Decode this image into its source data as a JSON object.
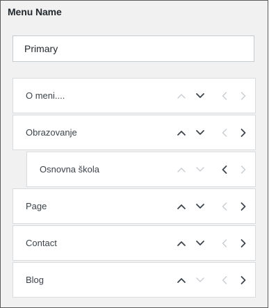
{
  "menu_name": {
    "label": "Menu Name",
    "value": "Primary"
  },
  "items": [
    {
      "label": "O meni....",
      "depth": 0,
      "move_up": false,
      "move_down": true,
      "move_out": false,
      "move_in": false
    },
    {
      "label": "Obrazovanje",
      "depth": 0,
      "move_up": true,
      "move_down": true,
      "move_out": false,
      "move_in": true
    },
    {
      "label": "Osnovna škola",
      "depth": 1,
      "move_up": false,
      "move_down": false,
      "move_out": true,
      "move_in": false
    },
    {
      "label": "Page",
      "depth": 0,
      "move_up": true,
      "move_down": true,
      "move_out": false,
      "move_in": true
    },
    {
      "label": "Contact",
      "depth": 0,
      "move_up": true,
      "move_down": true,
      "move_out": false,
      "move_in": true
    },
    {
      "label": "Blog",
      "depth": 0,
      "move_up": true,
      "move_down": false,
      "move_out": false,
      "move_in": true
    }
  ],
  "icons": {
    "up": "chevron-up-icon",
    "down": "chevron-down-icon",
    "left": "chevron-left-icon",
    "right": "chevron-right-icon"
  },
  "colors": {
    "active_arrow": "#3c434a",
    "disabled_arrow": "#c8ccd0",
    "panel_background": "#f1f1f1"
  }
}
